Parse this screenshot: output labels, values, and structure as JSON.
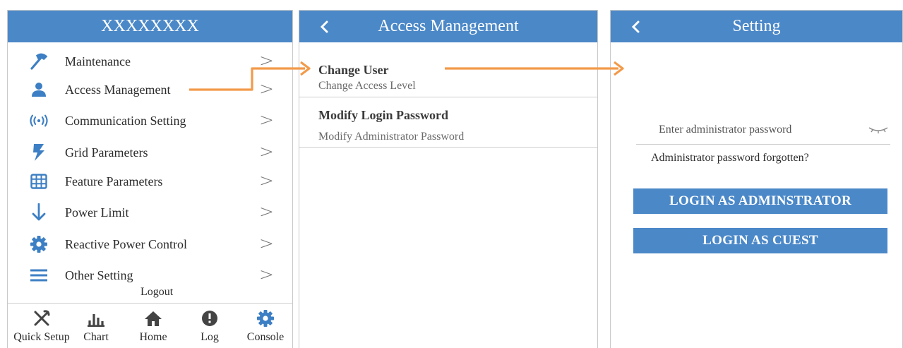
{
  "colors": {
    "header": "#4b88c8",
    "accent": "#3d7fc4",
    "arrow": "#f39a4a"
  },
  "screen1": {
    "title": "XXXXXXXX",
    "menu": [
      {
        "label": "Maintenance",
        "icon": "hammer-icon"
      },
      {
        "label": "Access Management",
        "icon": "user-icon"
      },
      {
        "label": "Communication Setting",
        "icon": "signal-icon"
      },
      {
        "label": "Grid Parameters",
        "icon": "lightning-icon"
      },
      {
        "label": "Feature Parameters",
        "icon": "grid-icon"
      },
      {
        "label": "Power Limit",
        "icon": "arrow-down-icon"
      },
      {
        "label": "Reactive Power Control",
        "icon": "gear-icon"
      },
      {
        "label": "Other Setting",
        "icon": "menu-lines-icon"
      }
    ],
    "chevron": ">",
    "logout": "Logout",
    "nav": [
      {
        "label": "Quick Setup",
        "icon": "tools-icon"
      },
      {
        "label": "Chart",
        "icon": "bar-chart-icon"
      },
      {
        "label": "Home",
        "icon": "home-icon"
      },
      {
        "label": "Log",
        "icon": "info-icon"
      },
      {
        "label": "Console",
        "icon": "gear-icon",
        "active": true
      }
    ]
  },
  "screen2": {
    "title": "Access Management",
    "back": "<",
    "items": [
      {
        "title": "Change User",
        "subtitle": "Change Access Level"
      },
      {
        "title": "Modify Login Password",
        "subtitle": "Modify Administrator Password"
      }
    ]
  },
  "screen3": {
    "title": "Setting",
    "back": "<",
    "password_placeholder": "Enter administrator password",
    "forgot": "Administrator password forgotten?",
    "btn_admin": "LOGIN AS ADMINSTRATOR",
    "btn_guest": "LOGIN AS CUEST"
  }
}
